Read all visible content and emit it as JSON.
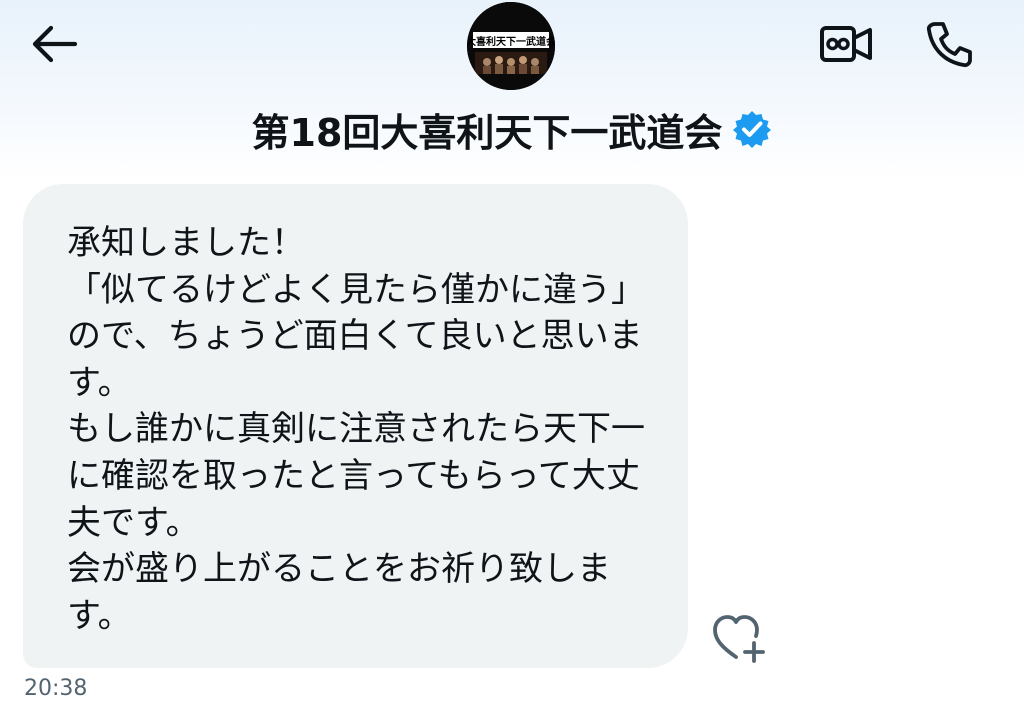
{
  "header": {
    "display_name": "第18回大喜利天下一武道会",
    "avatar_text": "大喜利天下一武道会",
    "icons": {
      "back": "arrow-left-icon",
      "avatar": "avatar-image",
      "video": "video-camera-icon",
      "call": "phone-icon",
      "verified": "verified-badge-icon"
    },
    "verified_color": "#1d9bf0"
  },
  "message": {
    "lines": [
      "承知しました！",
      "「似てるけどよく見たら僅かに違う」",
      "ので、ちょうど面白くて良いと思いま",
      "す。",
      "もし誰かに真剣に注意されたら天下一",
      "に確認を取ったと言ってもらって大丈",
      "夫です。",
      "会が盛り上がることをお祈り致しま",
      "す。"
    ],
    "timestamp": "20:38",
    "bubble_color": "#eff3f4",
    "like_icon": "heart-plus-icon"
  }
}
